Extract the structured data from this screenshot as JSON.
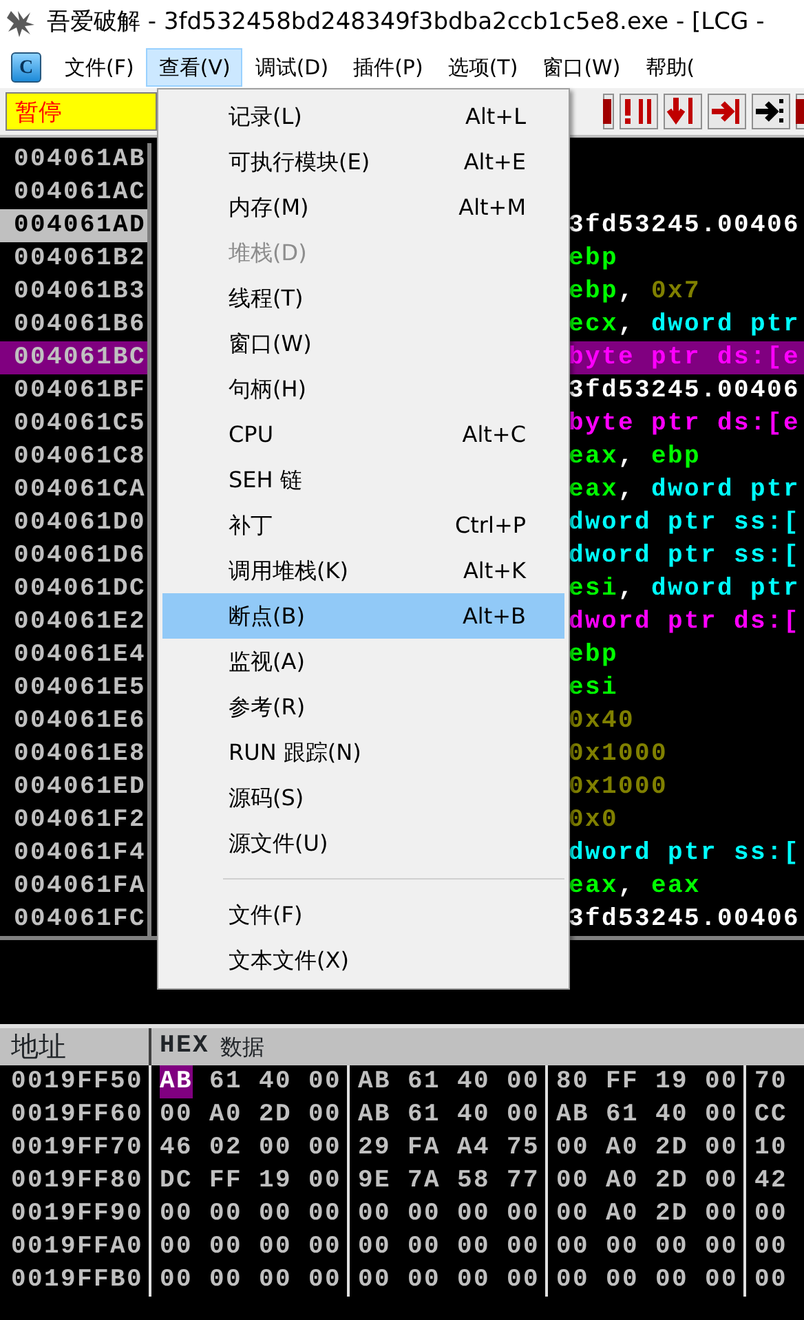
{
  "window": {
    "title": "吾爱破解 - 3fd532458bd248349f3bdba2ccb1c5e8.exe - [LCG -"
  },
  "menubar": {
    "logo_letter": "C",
    "items": [
      {
        "label": "文件(F)",
        "selected": false
      },
      {
        "label": "查看(V)",
        "selected": true
      },
      {
        "label": "调试(D)",
        "selected": false
      },
      {
        "label": "插件(P)",
        "selected": false
      },
      {
        "label": "选项(T)",
        "selected": false
      },
      {
        "label": "窗口(W)",
        "selected": false
      },
      {
        "label": "帮助(",
        "selected": false
      }
    ]
  },
  "toolbar": {
    "status": "暂停",
    "buttons": [
      {
        "kind": "partial"
      },
      {
        "kind": "step-in"
      },
      {
        "kind": "step-over"
      },
      {
        "kind": "return"
      },
      {
        "kind": "run-to"
      },
      {
        "kind": "partial"
      }
    ]
  },
  "menu": [
    {
      "kind": "item",
      "label": "记录(L)",
      "shortcut": "Alt+L",
      "disabled": false,
      "selected": false
    },
    {
      "kind": "item",
      "label": "可执行模块(E)",
      "shortcut": "Alt+E",
      "disabled": false,
      "selected": false
    },
    {
      "kind": "item",
      "label": "内存(M)",
      "shortcut": "Alt+M",
      "disabled": false,
      "selected": false
    },
    {
      "kind": "item",
      "label": "堆栈(D)",
      "disabled": true,
      "selected": false
    },
    {
      "kind": "item",
      "label": "线程(T)",
      "disabled": false,
      "selected": false
    },
    {
      "kind": "item",
      "label": "窗口(W)",
      "disabled": false,
      "selected": false
    },
    {
      "kind": "item",
      "label": "句柄(H)",
      "disabled": false,
      "selected": false
    },
    {
      "kind": "item",
      "label": "CPU",
      "shortcut": "Alt+C",
      "disabled": false,
      "selected": false
    },
    {
      "kind": "item",
      "label": "SEH 链",
      "disabled": false,
      "selected": false
    },
    {
      "kind": "item",
      "label": "补丁",
      "shortcut": "Ctrl+P",
      "disabled": false,
      "selected": false
    },
    {
      "kind": "item",
      "label": "调用堆栈(K)",
      "shortcut": "Alt+K",
      "disabled": false,
      "selected": false
    },
    {
      "kind": "item",
      "label": "断点(B)",
      "shortcut": "Alt+B",
      "disabled": false,
      "selected": true
    },
    {
      "kind": "item",
      "label": "监视(A)",
      "disabled": false,
      "selected": false
    },
    {
      "kind": "item",
      "label": "参考(R)",
      "disabled": false,
      "selected": false
    },
    {
      "kind": "item",
      "label": "RUN 跟踪(N)",
      "disabled": false,
      "selected": false
    },
    {
      "kind": "item",
      "label": "源码(S)",
      "disabled": false,
      "selected": false
    },
    {
      "kind": "item",
      "label": "源文件(U)",
      "disabled": false,
      "selected": false
    },
    {
      "kind": "separator"
    },
    {
      "kind": "item",
      "label": "文件(F)",
      "disabled": false,
      "selected": false
    },
    {
      "kind": "item",
      "label": "文本文件(X)",
      "disabled": false,
      "selected": false
    }
  ],
  "disassembly": [
    {
      "address": "004061AB",
      "selected": false,
      "marked": false
    },
    {
      "address": "004061AC",
      "selected": false,
      "marked": false
    },
    {
      "address": "004061AD",
      "selected": true,
      "marked": false,
      "operand": [
        {
          "text": "3fd53245.00406",
          "kind": "label"
        }
      ]
    },
    {
      "address": "004061B2",
      "selected": false,
      "marked": false,
      "operand": [
        {
          "text": "ebp",
          "kind": "reg"
        }
      ]
    },
    {
      "address": "004061B3",
      "selected": false,
      "marked": false,
      "operand": [
        {
          "text": "ebp",
          "kind": "reg"
        },
        {
          "text": ", ",
          "kind": "punct"
        },
        {
          "text": "0x7",
          "kind": "const"
        }
      ]
    },
    {
      "address": "004061B6",
      "selected": false,
      "marked": false,
      "operand": [
        {
          "text": "ecx",
          "kind": "reg"
        },
        {
          "text": ", ",
          "kind": "punct"
        },
        {
          "text": "dword ptr",
          "kind": "ptr"
        }
      ]
    },
    {
      "address": "004061BC",
      "selected": false,
      "marked": true,
      "operand": [
        {
          "text": "byte ptr ds:[e",
          "kind": "mem"
        }
      ]
    },
    {
      "address": "004061BF",
      "selected": false,
      "marked": false,
      "operand": [
        {
          "text": "3fd53245.00406",
          "kind": "label"
        }
      ]
    },
    {
      "address": "004061C5",
      "selected": false,
      "marked": false,
      "operand": [
        {
          "text": "byte ptr ds:[e",
          "kind": "mem"
        }
      ]
    },
    {
      "address": "004061C8",
      "selected": false,
      "marked": false,
      "operand": [
        {
          "text": "eax",
          "kind": "reg"
        },
        {
          "text": ", ",
          "kind": "punct"
        },
        {
          "text": "ebp",
          "kind": "reg"
        }
      ]
    },
    {
      "address": "004061CA",
      "selected": false,
      "marked": false,
      "operand": [
        {
          "text": "eax",
          "kind": "reg"
        },
        {
          "text": ", ",
          "kind": "punct"
        },
        {
          "text": "dword ptr",
          "kind": "ptr"
        }
      ]
    },
    {
      "address": "004061D0",
      "selected": false,
      "marked": false,
      "operand": [
        {
          "text": "dword ptr ss:[",
          "kind": "ptr"
        }
      ]
    },
    {
      "address": "004061D6",
      "selected": false,
      "marked": false,
      "operand": [
        {
          "text": "dword ptr ss:[",
          "kind": "ptr"
        }
      ]
    },
    {
      "address": "004061DC",
      "selected": false,
      "marked": false,
      "operand": [
        {
          "text": "esi",
          "kind": "reg"
        },
        {
          "text": ", ",
          "kind": "punct"
        },
        {
          "text": "dword ptr",
          "kind": "ptr"
        }
      ]
    },
    {
      "address": "004061E2",
      "selected": false,
      "marked": false,
      "operand": [
        {
          "text": "dword ptr ds:[",
          "kind": "mem"
        }
      ]
    },
    {
      "address": "004061E4",
      "selected": false,
      "marked": false,
      "operand": [
        {
          "text": "ebp",
          "kind": "reg"
        }
      ]
    },
    {
      "address": "004061E5",
      "selected": false,
      "marked": false,
      "operand": [
        {
          "text": "esi",
          "kind": "reg"
        }
      ]
    },
    {
      "address": "004061E6",
      "selected": false,
      "marked": false,
      "operand": [
        {
          "text": "0x40",
          "kind": "const"
        }
      ]
    },
    {
      "address": "004061E8",
      "selected": false,
      "marked": false,
      "operand": [
        {
          "text": "0x1000",
          "kind": "const"
        }
      ]
    },
    {
      "address": "004061ED",
      "selected": false,
      "marked": false,
      "operand": [
        {
          "text": "0x1000",
          "kind": "const"
        }
      ]
    },
    {
      "address": "004061F2",
      "selected": false,
      "marked": false,
      "operand": [
        {
          "text": "0x0",
          "kind": "const"
        }
      ]
    },
    {
      "address": "004061F4",
      "selected": false,
      "marked": false,
      "operand": [
        {
          "text": "dword ptr ss:[",
          "kind": "ptr"
        }
      ]
    },
    {
      "address": "004061FA",
      "selected": false,
      "marked": false,
      "operand": [
        {
          "text": "eax",
          "kind": "reg"
        },
        {
          "text": ", ",
          "kind": "punct"
        },
        {
          "text": "eax",
          "kind": "reg"
        }
      ]
    },
    {
      "address": "004061FC",
      "selected": false,
      "marked": false,
      "operand": [
        {
          "text": "3fd53245.00406",
          "kind": "label"
        }
      ]
    }
  ],
  "dump": {
    "columns": [
      "地址",
      "HEX",
      "数据"
    ],
    "rows": [
      {
        "address": "0019FF50",
        "bytes": [
          {
            "text": "AB",
            "selected": true
          },
          {
            "text": "61",
            "selected": false
          },
          {
            "text": "40",
            "selected": false
          },
          {
            "text": "00",
            "selected": false
          },
          {
            "text": "AB",
            "selected": false
          },
          {
            "text": "61",
            "selected": false
          },
          {
            "text": "40",
            "selected": false
          },
          {
            "text": "00",
            "selected": false
          },
          {
            "text": "80",
            "selected": false
          },
          {
            "text": "FF",
            "selected": false
          },
          {
            "text": "19",
            "selected": false
          },
          {
            "text": "00",
            "selected": false
          },
          {
            "text": "70",
            "selected": false
          }
        ]
      },
      {
        "address": "0019FF60",
        "bytes": [
          {
            "text": "00",
            "selected": false
          },
          {
            "text": "A0",
            "selected": false
          },
          {
            "text": "2D",
            "selected": false
          },
          {
            "text": "00",
            "selected": false
          },
          {
            "text": "AB",
            "selected": false
          },
          {
            "text": "61",
            "selected": false
          },
          {
            "text": "40",
            "selected": false
          },
          {
            "text": "00",
            "selected": false
          },
          {
            "text": "AB",
            "selected": false
          },
          {
            "text": "61",
            "selected": false
          },
          {
            "text": "40",
            "selected": false
          },
          {
            "text": "00",
            "selected": false
          },
          {
            "text": "CC",
            "selected": false
          }
        ]
      },
      {
        "address": "0019FF70",
        "bytes": [
          {
            "text": "46",
            "selected": false
          },
          {
            "text": "02",
            "selected": false
          },
          {
            "text": "00",
            "selected": false
          },
          {
            "text": "00",
            "selected": false
          },
          {
            "text": "29",
            "selected": false
          },
          {
            "text": "FA",
            "selected": false
          },
          {
            "text": "A4",
            "selected": false
          },
          {
            "text": "75",
            "selected": false
          },
          {
            "text": "00",
            "selected": false
          },
          {
            "text": "A0",
            "selected": false
          },
          {
            "text": "2D",
            "selected": false
          },
          {
            "text": "00",
            "selected": false
          },
          {
            "text": "10",
            "selected": false
          }
        ]
      },
      {
        "address": "0019FF80",
        "bytes": [
          {
            "text": "DC",
            "selected": false
          },
          {
            "text": "FF",
            "selected": false
          },
          {
            "text": "19",
            "selected": false
          },
          {
            "text": "00",
            "selected": false
          },
          {
            "text": "9E",
            "selected": false
          },
          {
            "text": "7A",
            "selected": false
          },
          {
            "text": "58",
            "selected": false
          },
          {
            "text": "77",
            "selected": false
          },
          {
            "text": "00",
            "selected": false
          },
          {
            "text": "A0",
            "selected": false
          },
          {
            "text": "2D",
            "selected": false
          },
          {
            "text": "00",
            "selected": false
          },
          {
            "text": "42",
            "selected": false
          }
        ]
      },
      {
        "address": "0019FF90",
        "bytes": [
          {
            "text": "00",
            "selected": false
          },
          {
            "text": "00",
            "selected": false
          },
          {
            "text": "00",
            "selected": false
          },
          {
            "text": "00",
            "selected": false
          },
          {
            "text": "00",
            "selected": false
          },
          {
            "text": "00",
            "selected": false
          },
          {
            "text": "00",
            "selected": false
          },
          {
            "text": "00",
            "selected": false
          },
          {
            "text": "00",
            "selected": false
          },
          {
            "text": "A0",
            "selected": false
          },
          {
            "text": "2D",
            "selected": false
          },
          {
            "text": "00",
            "selected": false
          },
          {
            "text": "00",
            "selected": false
          }
        ]
      },
      {
        "address": "0019FFA0",
        "bytes": [
          {
            "text": "00",
            "selected": false
          },
          {
            "text": "00",
            "selected": false
          },
          {
            "text": "00",
            "selected": false
          },
          {
            "text": "00",
            "selected": false
          },
          {
            "text": "00",
            "selected": false
          },
          {
            "text": "00",
            "selected": false
          },
          {
            "text": "00",
            "selected": false
          },
          {
            "text": "00",
            "selected": false
          },
          {
            "text": "00",
            "selected": false
          },
          {
            "text": "00",
            "selected": false
          },
          {
            "text": "00",
            "selected": false
          },
          {
            "text": "00",
            "selected": false
          },
          {
            "text": "00",
            "selected": false
          }
        ]
      },
      {
        "address": "0019FFB0",
        "bytes": [
          {
            "text": "00",
            "selected": false
          },
          {
            "text": "00",
            "selected": false
          },
          {
            "text": "00",
            "selected": false
          },
          {
            "text": "00",
            "selected": false
          },
          {
            "text": "00",
            "selected": false
          },
          {
            "text": "00",
            "selected": false
          },
          {
            "text": "00",
            "selected": false
          },
          {
            "text": "00",
            "selected": false
          },
          {
            "text": "00",
            "selected": false
          },
          {
            "text": "00",
            "selected": false
          },
          {
            "text": "00",
            "selected": false
          },
          {
            "text": "00",
            "selected": false
          },
          {
            "text": "00",
            "selected": false
          }
        ]
      }
    ]
  }
}
